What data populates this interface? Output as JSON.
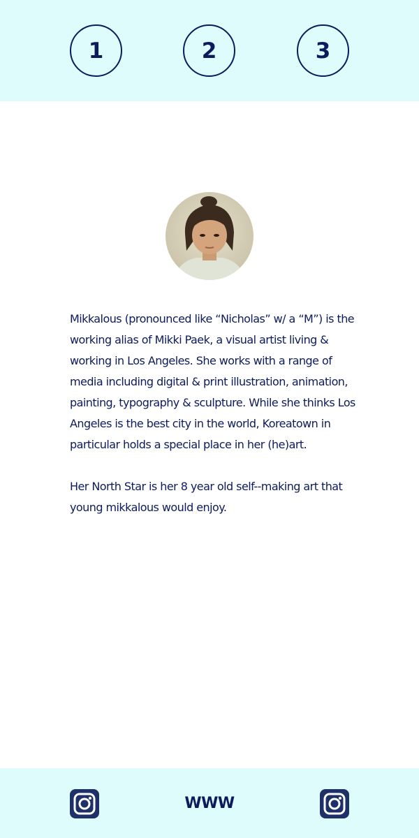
{
  "nav": {
    "items": [
      {
        "label": "1"
      },
      {
        "label": "2"
      },
      {
        "label": "3"
      }
    ]
  },
  "bio": {
    "paragraphs": [
      "Mikkalous (pronounced like “Nicholas” w/ a “M”) is the working alias of Mikki Paek, a visual artist living & working in Los Angeles. She works with a range of media including digital & print illustration, animation, painting, typography & sculpture. While she thinks Los Angeles is the best city in the world, Koreatown in particular holds a special place in her (he)art.",
      "Her North Star is her 8 year old self--making art that young mikkalous would enjoy."
    ]
  },
  "footer": {
    "left_icon": "instagram-icon",
    "website_label": "WWW",
    "right_icon": "instagram-icon"
  },
  "colors": {
    "accent": "#0d1b5c",
    "band_background": "#dffcfd",
    "page_background": "#ffffff"
  }
}
